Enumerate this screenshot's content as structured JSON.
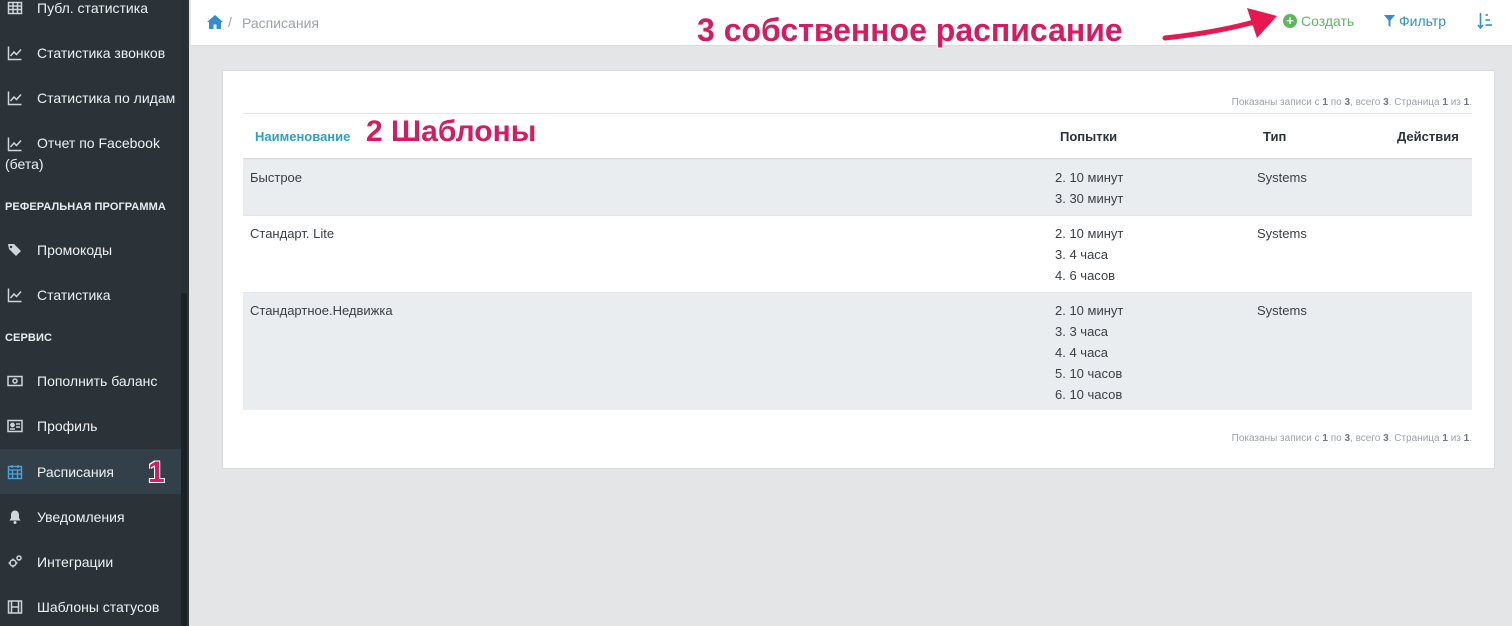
{
  "sidebar": {
    "items": [
      {
        "label": "Публ. статистика",
        "icon": "table-icon"
      },
      {
        "label": "Статистика звонков",
        "icon": "line-chart-icon"
      },
      {
        "label": "Статистика по лидам",
        "icon": "line-chart-icon"
      },
      {
        "label": "Отчет по Facebook (бета)",
        "icon": "line-chart-icon"
      },
      {
        "label": "Промокоды",
        "icon": "tags-icon"
      },
      {
        "label": "Статистика",
        "icon": "line-chart-icon"
      },
      {
        "label": "Пополнить баланс",
        "icon": "money-icon"
      },
      {
        "label": "Профиль",
        "icon": "id-card-icon"
      },
      {
        "label": "Расписания",
        "icon": "calendar-icon"
      },
      {
        "label": "Уведомления",
        "icon": "bell-icon"
      },
      {
        "label": "Интеграции",
        "icon": "cogs-icon"
      },
      {
        "label": "Шаблоны статусов",
        "icon": "film-icon"
      }
    ],
    "sections": {
      "referral": "РЕФЕРАЛЬНАЯ ПРОГРАММА",
      "service": "СЕРВИС"
    },
    "active": "Расписания"
  },
  "breadcrumb": {
    "separator": "/",
    "current": "Расписания"
  },
  "toolbar": {
    "create_label": "Создать",
    "filter_label": "Фильтр"
  },
  "annotations": {
    "a1": "1",
    "a2": "2 Шаблоны",
    "a3": "3 собственное расписание"
  },
  "pager": {
    "prefix": "Показаны записи с",
    "from": "1",
    "mid1": "по",
    "to": "3",
    "mid2": ", всего",
    "total": "3",
    "mid3": ". Страница",
    "page": "1",
    "mid4": "из",
    "pages": "1",
    "suffix": "."
  },
  "table": {
    "columns": {
      "name": "Наименование",
      "attempts": "Попытки",
      "type": "Тип",
      "actions": "Действия"
    },
    "rows": [
      {
        "name": "Быстрое",
        "attempts": [
          "2. 10 минут",
          "3. 30 минут"
        ],
        "type": "Systems"
      },
      {
        "name": "Стандарт. Lite",
        "attempts": [
          "2. 10 минут",
          "3. 4 часа",
          "4. 6 часов"
        ],
        "type": "Systems"
      },
      {
        "name": "Стандартное.Недвижка",
        "attempts": [
          "2. 10 минут",
          "3. 3 часа",
          "4. 4 часа",
          "5. 10 часов",
          "6. 10 часов"
        ],
        "type": "Systems"
      }
    ]
  },
  "colors": {
    "sidebar_bg": "#2b3338",
    "accent": "#2fa0c8",
    "create_green": "#5cb85c",
    "annotation": "#d81b60"
  }
}
